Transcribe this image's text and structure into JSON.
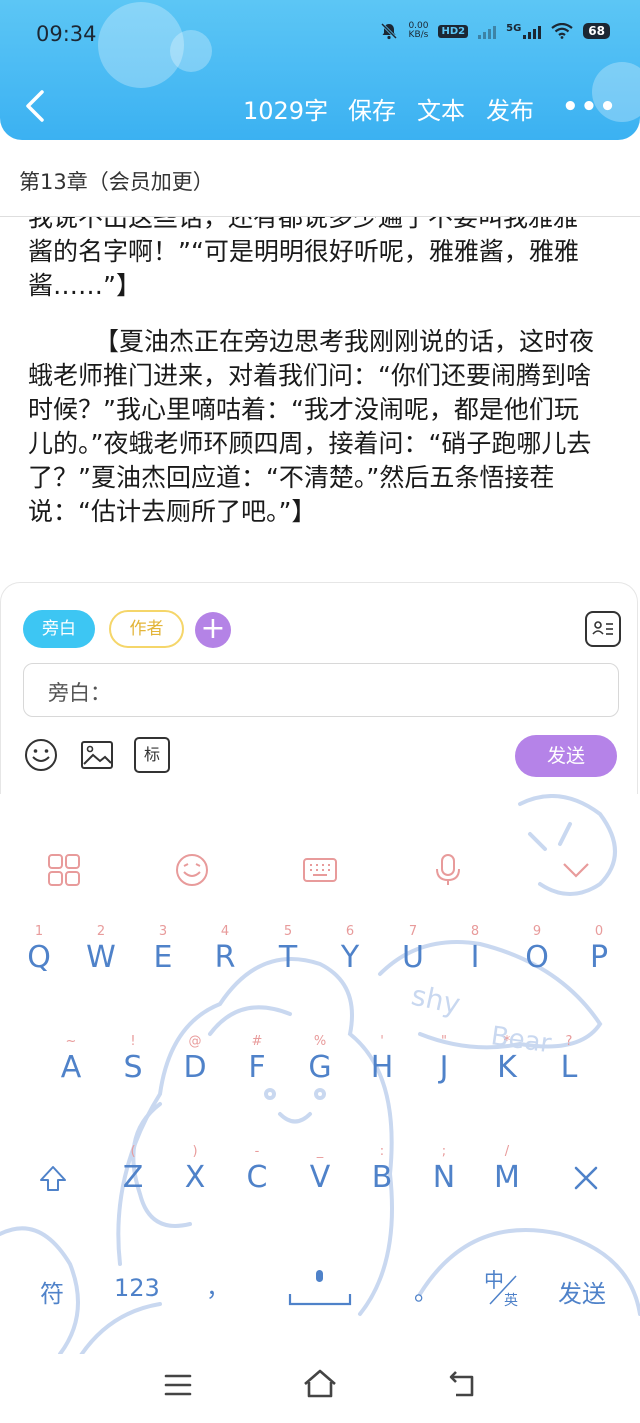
{
  "status_bar": {
    "time": "09:34",
    "net_speed_top": "0.00",
    "net_speed_bottom": "KB/s",
    "hd": "HD2",
    "network": "5G",
    "battery": "68"
  },
  "toolbar": {
    "word_count": "1029字",
    "save": "保存",
    "text": "文本",
    "publish": "发布",
    "more": "•••"
  },
  "chapter": {
    "title": "第13章（会员加更）"
  },
  "content": {
    "paragraphs": [
      "我说不出这些话，还有都说多少遍了不要叫我雅雅酱的名字啊！”“可是明明很好听呢，雅雅酱，雅雅酱……”】",
      "【夏油杰正在旁边思考我刚刚说的话，这时夜蛾老师推门进来，对着我们问：“你们还要闹腾到啥时候？”我心里嘀咕着：“我才没闹呢，都是他们玩儿的。”夜蛾老师环顾四周，接着问：“硝子跑哪儿去了？”夏油杰回应道：“不清楚。”然后五条悟接茬说：“估计去厕所了吧。”】"
    ]
  },
  "composer": {
    "chip_narration": "旁白",
    "chip_author": "作者",
    "plus": "+",
    "input_placeholder": "旁白：",
    "tag_button": "标",
    "send": "发送"
  },
  "keyboard": {
    "row1": [
      {
        "sub": "1",
        "key": "Q"
      },
      {
        "sub": "2",
        "key": "W"
      },
      {
        "sub": "3",
        "key": "E"
      },
      {
        "sub": "4",
        "key": "R"
      },
      {
        "sub": "5",
        "key": "T"
      },
      {
        "sub": "6",
        "key": "Y"
      },
      {
        "sub": "7",
        "key": "U"
      },
      {
        "sub": "8",
        "key": "I"
      },
      {
        "sub": "9",
        "key": "O"
      },
      {
        "sub": "0",
        "key": "P"
      }
    ],
    "row2": [
      {
        "sub": "~",
        "key": "A"
      },
      {
        "sub": "!",
        "key": "S"
      },
      {
        "sub": "@",
        "key": "D"
      },
      {
        "sub": "#",
        "key": "F"
      },
      {
        "sub": "%",
        "key": "G"
      },
      {
        "sub": "'",
        "key": "H"
      },
      {
        "sub": "\"",
        "key": "J"
      },
      {
        "sub": "*",
        "key": "K"
      },
      {
        "sub": "?",
        "key": "L"
      }
    ],
    "row3": [
      {
        "sub": "(",
        "key": "Z"
      },
      {
        "sub": ")",
        "key": "X"
      },
      {
        "sub": "-",
        "key": "C"
      },
      {
        "sub": "_",
        "key": "V"
      },
      {
        "sub": ":",
        "key": "B"
      },
      {
        "sub": ";",
        "key": "N"
      },
      {
        "sub": "/",
        "key": "M"
      }
    ],
    "bottom": {
      "symbols": "符",
      "numbers": "123",
      "comma": "，",
      "period": "。",
      "lang_top": "中",
      "lang_bottom": "英",
      "send": "发送"
    },
    "decor_text_1": "shy",
    "decor_text_2": "Bear"
  },
  "colors": {
    "header": "#3bb1f2",
    "chip_narration": "#3dc6f3",
    "accent_purple": "#b483e6",
    "key_letter": "#4f82c9",
    "key_sub": "#e89b9b"
  }
}
